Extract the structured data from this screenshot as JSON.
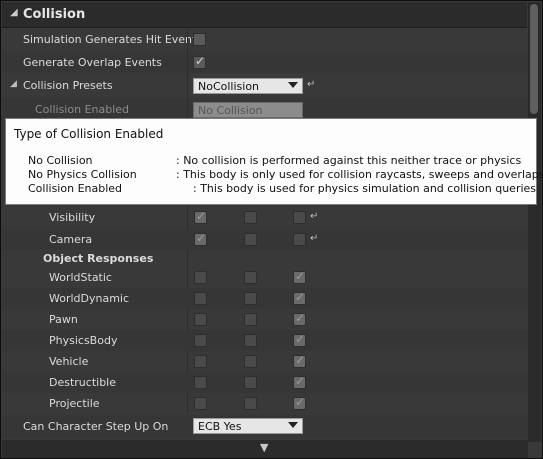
{
  "section": {
    "title": "Collision"
  },
  "properties": {
    "sim_hit": {
      "label": "Simulation Generates Hit Events",
      "checked": false
    },
    "overlap": {
      "label": "Generate Overlap Events",
      "checked": true
    },
    "presets": {
      "label": "Collision Presets",
      "value": "NoCollision"
    },
    "enabled": {
      "label": "Collision Enabled",
      "value": "No Collision"
    }
  },
  "tooltip": {
    "title": "Type of Collision Enabled",
    "lines": [
      {
        "name": "No Collision",
        "desc": ": No collision is performed against this neither trace or physics"
      },
      {
        "name": "No Physics Collision",
        "desc": ": This body is only used for collision raycasts, sweeps and overlaps"
      },
      {
        "name": "Collision Enabled",
        "desc": ": This body is used for physics simulation and collision queries"
      }
    ]
  },
  "trace_responses": [
    {
      "label": "Visibility",
      "ignore": true,
      "overlap": false,
      "block": true
    },
    {
      "label": "Camera",
      "ignore": true,
      "overlap": false,
      "block": false
    }
  ],
  "object_responses_title": "Object Responses",
  "object_responses": [
    {
      "label": "WorldStatic",
      "ignore": false,
      "overlap": false,
      "block": true
    },
    {
      "label": "WorldDynamic",
      "ignore": false,
      "overlap": false,
      "block": true
    },
    {
      "label": "Pawn",
      "ignore": false,
      "overlap": false,
      "block": true
    },
    {
      "label": "PhysicsBody",
      "ignore": false,
      "overlap": false,
      "block": true
    },
    {
      "label": "Vehicle",
      "ignore": false,
      "overlap": false,
      "block": true
    },
    {
      "label": "Destructible",
      "ignore": false,
      "overlap": false,
      "block": true
    },
    {
      "label": "Projectile",
      "ignore": false,
      "overlap": false,
      "block": true
    }
  ],
  "step_up": {
    "label": "Can Character Step Up On",
    "value": "ECB Yes"
  },
  "icons": {
    "section_arrow": "collapse-triangle-icon",
    "reset": "reset-to-default-icon",
    "expand": "expand-chevron-icon"
  }
}
